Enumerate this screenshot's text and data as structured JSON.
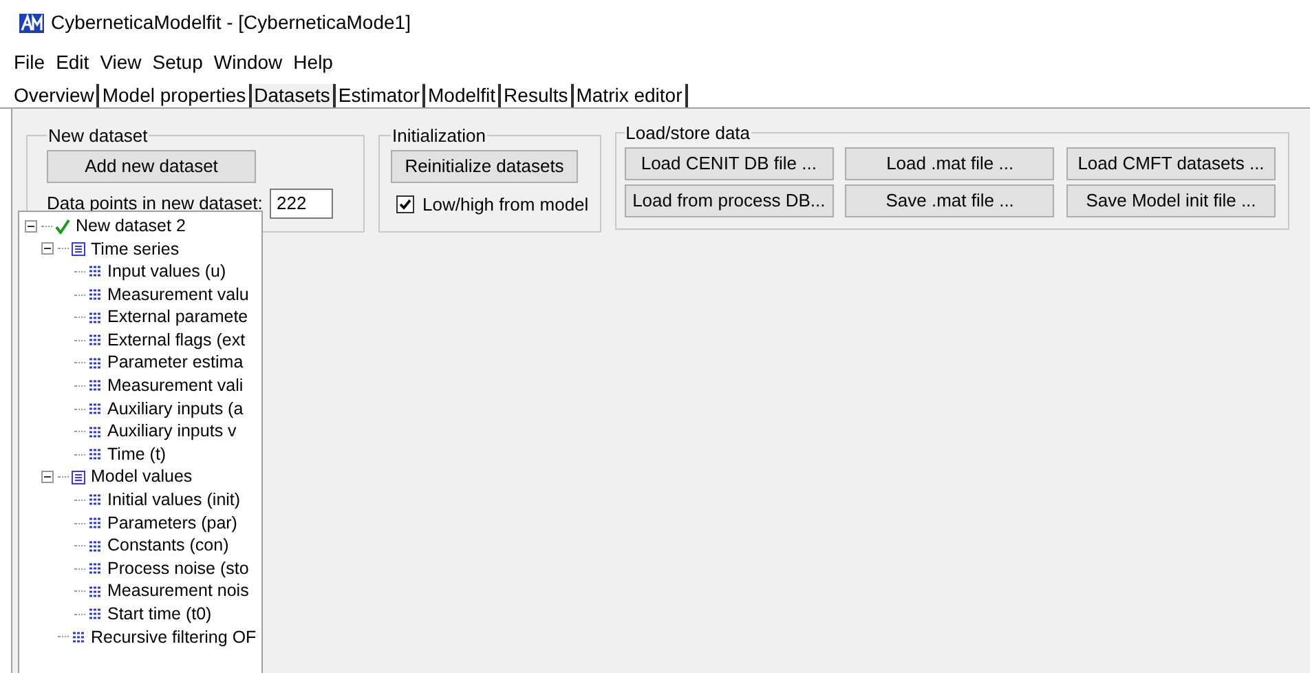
{
  "window": {
    "title": "CyberneticaModelfit - [CyberneticaMode1]"
  },
  "menu": [
    "File",
    "Edit",
    "View",
    "Setup",
    "Window",
    "Help"
  ],
  "tabs": [
    {
      "label": "Overview",
      "selected": false
    },
    {
      "label": "Model properties",
      "selected": false
    },
    {
      "label": "Datasets",
      "selected": true
    },
    {
      "label": "Estimator",
      "selected": false
    },
    {
      "label": "Modelfit",
      "selected": false
    },
    {
      "label": "Results",
      "selected": false
    },
    {
      "label": "Matrix editor",
      "selected": false
    }
  ],
  "new_dataset": {
    "title": "New dataset",
    "button": "Add new dataset",
    "points_label": "Data points in new dataset:",
    "points_value": "222"
  },
  "initialization": {
    "title": "Initialization",
    "button": "Reinitialize datasets",
    "checkbox": {
      "label": "Low/high from model",
      "checked": true
    }
  },
  "load_store": {
    "title": "Load/store data",
    "buttons": [
      "Load CENIT DB file ...",
      "Load .mat file ...",
      "Load CMFT datasets ...",
      "Load from process DB...",
      "Save .mat file ...",
      "Save Model init file ..."
    ]
  },
  "tree": [
    {
      "label": "New dataset 2",
      "kind": "dataset",
      "expanded": true,
      "children": [
        {
          "label": "Time series",
          "kind": "group",
          "expanded": true,
          "children": [
            {
              "label": "Input values (u)",
              "kind": "leaf"
            },
            {
              "label": "Measurement valu",
              "kind": "leaf"
            },
            {
              "label": "External paramete",
              "kind": "leaf"
            },
            {
              "label": "External flags (ext",
              "kind": "leaf"
            },
            {
              "label": "Parameter estima",
              "kind": "leaf"
            },
            {
              "label": "Measurement vali",
              "kind": "leaf"
            },
            {
              "label": "Auxiliary inputs (a",
              "kind": "leaf"
            },
            {
              "label": "Auxiliary inputs v",
              "kind": "leaf"
            },
            {
              "label": "Time (t)",
              "kind": "leaf"
            }
          ]
        },
        {
          "label": "Model values",
          "kind": "group",
          "expanded": true,
          "children": [
            {
              "label": "Initial values (init)",
              "kind": "leaf"
            },
            {
              "label": "Parameters (par)",
              "kind": "leaf"
            },
            {
              "label": "Constants (con)",
              "kind": "leaf"
            },
            {
              "label": "Process noise (sto",
              "kind": "leaf"
            },
            {
              "label": "Measurement nois",
              "kind": "leaf"
            },
            {
              "label": "Start time (t0)",
              "kind": "leaf"
            }
          ]
        },
        {
          "label": "Recursive filtering OF",
          "kind": "leaf"
        }
      ]
    }
  ]
}
